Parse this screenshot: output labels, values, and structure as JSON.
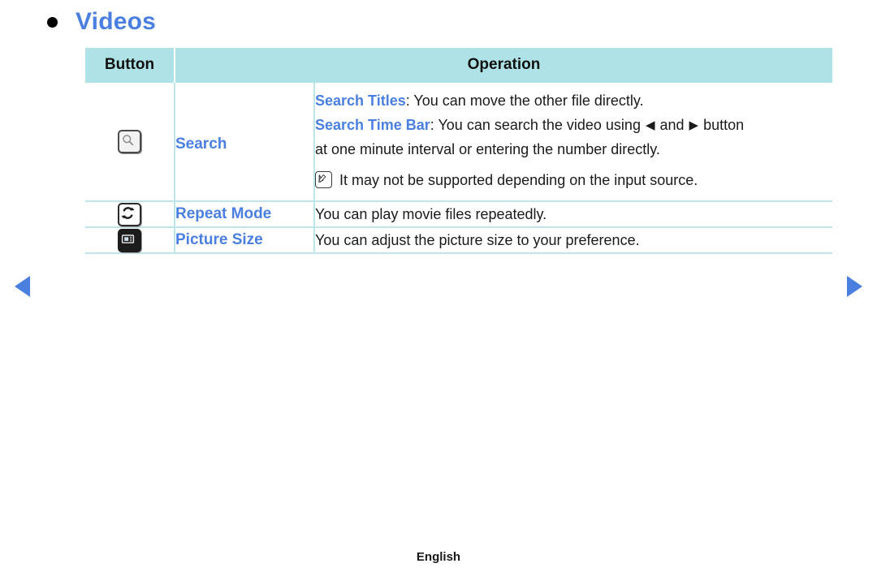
{
  "page": {
    "title": "Videos",
    "bullet_icon": "bullet-dot-icon",
    "footer_label": "English"
  },
  "navigation": {
    "prev_icon": "triangle-left-icon",
    "next_icon": "triangle-right-icon",
    "accent_color": "#4a7fe0"
  },
  "colors": {
    "header_background": "#aee2e6",
    "table_border": "#bfe5e8",
    "link_blue": "#4a7fe0",
    "body_text": "#1a1a1a"
  },
  "table": {
    "headers": {
      "button": "Button",
      "operation": "Operation"
    },
    "rows": [
      {
        "icon": "search-button-icon",
        "name": "Search",
        "lines": [
          {
            "type": "keyword",
            "keyword": "Search Titles",
            "separator": ": ",
            "text": "You can move the other file directly."
          },
          {
            "type": "keyword-arrows",
            "keyword": "Search Time Bar",
            "separator": ": ",
            "text_before": "You can search the video using ",
            "arrow_left": "◀",
            "text_middle": " and ",
            "arrow_right": "▶",
            "text_after": " button"
          },
          {
            "type": "plain",
            "text": "at one minute interval or entering the number directly."
          },
          {
            "type": "note",
            "icon": "note-icon",
            "text": "It may not be supported depending on the input source."
          }
        ]
      },
      {
        "icon": "repeat-mode-icon",
        "name": "Repeat Mode",
        "lines": [
          {
            "type": "plain",
            "text": "You can play movie files repeatedly."
          }
        ]
      },
      {
        "icon": "picture-size-icon",
        "name": "Picture Size",
        "lines": [
          {
            "type": "plain",
            "text": "You can adjust the picture size to your preference."
          }
        ]
      }
    ]
  }
}
